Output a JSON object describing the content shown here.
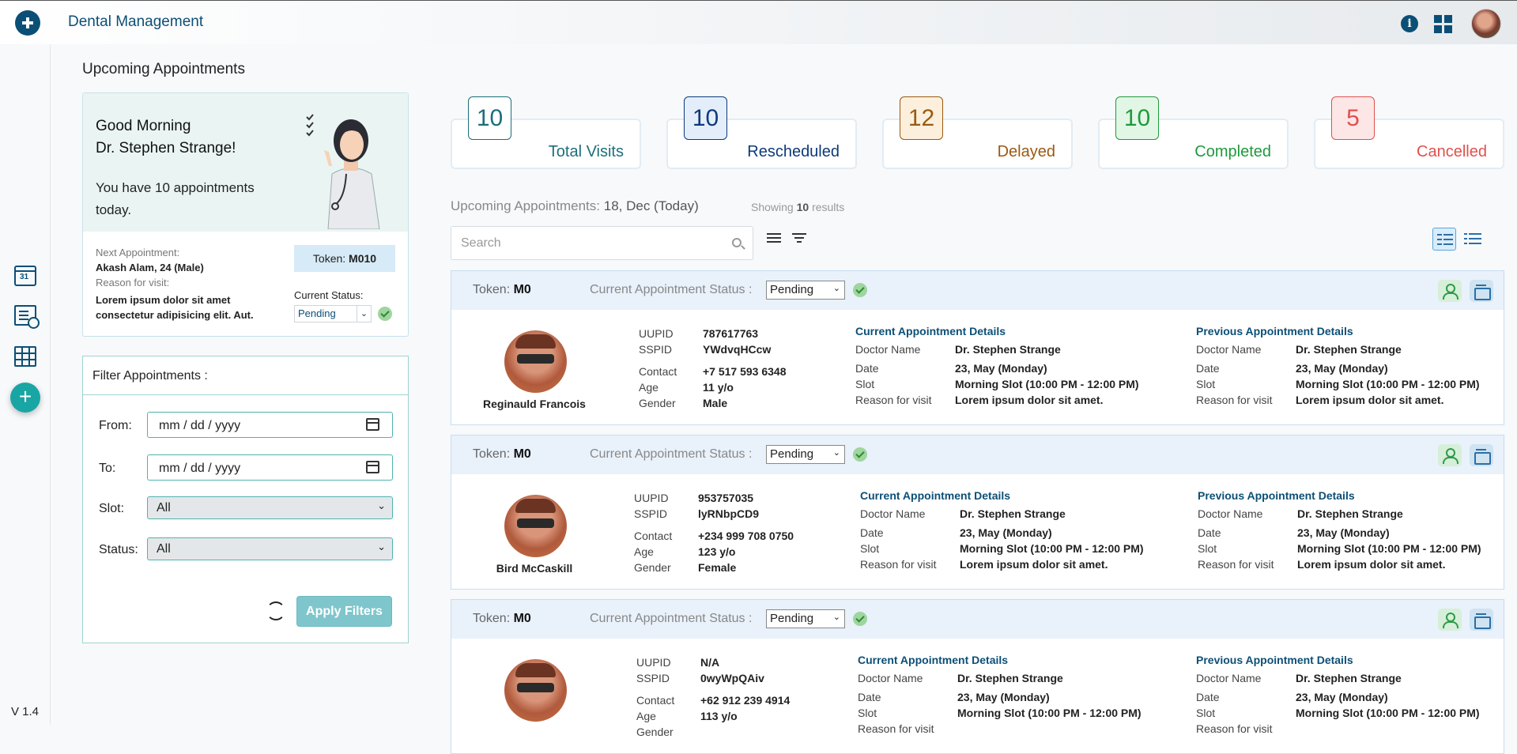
{
  "app": {
    "title": "Dental Management",
    "version": "V 1.4"
  },
  "page_title": "Upcoming Appointments",
  "welcome": {
    "greeting_line1": "Good Morning",
    "greeting_line2": "Dr. Stephen Strange!",
    "appointments_text": "You have 10 appointments today.",
    "next_label": "Next Appointment:",
    "next_value": "Akash Alam, 24 (Male)",
    "reason_label": "Reason for visit:",
    "reason_value": "Lorem ipsum dolor sit amet consectetur adipisicing elit. Aut.",
    "token_label": "Token: ",
    "token_value": "M010",
    "status_label": "Current Status:",
    "status_value": "Pending"
  },
  "filter": {
    "title": "Filter Appointments :",
    "from_label": "From:",
    "from_value": "mm / dd / yyyy",
    "to_label": "To:",
    "to_value": "mm / dd / yyyy",
    "slot_label": "Slot:",
    "slot_value": "All",
    "status_label": "Status:",
    "status_value": "All",
    "apply_label": "Apply Filters"
  },
  "stats": [
    {
      "num": "10",
      "label": "Total Visits",
      "color": "#1c6e7a",
      "bg": "#ffffff"
    },
    {
      "num": "10",
      "label": "Rescheduled",
      "color": "#0d3a7a",
      "bg": "#e4eefb"
    },
    {
      "num": "12",
      "label": "Delayed",
      "color": "#9a5a10",
      "bg": "#fcefdc"
    },
    {
      "num": "10",
      "label": "Completed",
      "color": "#1e9a3c",
      "bg": "#e2f6e6"
    },
    {
      "num": "5",
      "label": "Cancelled",
      "color": "#e0504e",
      "bg": "#fde6e6"
    }
  ],
  "list_header": {
    "title": "Upcoming Appointments:",
    "date": "18, Dec (Today)",
    "showing_pre": "Showing",
    "showing_count": "10",
    "showing_post": "results"
  },
  "search": {
    "placeholder": "Search"
  },
  "card_labels": {
    "token": "Token:",
    "status": "Current Appointment Status :",
    "uupid": "UUPID",
    "sspid": "SSPID",
    "contact": "Contact",
    "age": "Age",
    "gender": "Gender",
    "current_title": "Current Appointment Details",
    "previous_title": "Previous Appointment Details",
    "doctor": "Doctor Name",
    "date": "Date",
    "slot": "Slot",
    "reason": "Reason for visit"
  },
  "appointments": [
    {
      "token": "M0",
      "status": "Pending",
      "name": "Reginauld Francois",
      "uupid": "787617763",
      "sspid": "YWdvqHCcw",
      "contact": "+7 517 593 6348",
      "age": "11 y/o",
      "gender": "Male",
      "cur_doctor": "Dr. Stephen Strange",
      "cur_date": "23, May (Monday)",
      "cur_slot": "Morning Slot (10:00 PM - 12:00 PM)",
      "cur_reason": "Lorem ipsum dolor sit amet.",
      "prev_doctor": "Dr. Stephen Strange",
      "prev_date": "23, May (Monday)",
      "prev_slot": "Morning Slot (10:00 PM - 12:00 PM)",
      "prev_reason": "Lorem ipsum dolor sit amet."
    },
    {
      "token": "M0",
      "status": "Pending",
      "name": "Bird McCaskill",
      "uupid": "953757035",
      "sspid": "lyRNbpCD9",
      "contact": "+234 999 708 0750",
      "age": "123 y/o",
      "gender": "Female",
      "cur_doctor": "Dr. Stephen Strange",
      "cur_date": "23, May (Monday)",
      "cur_slot": "Morning Slot (10:00 PM - 12:00 PM)",
      "cur_reason": "Lorem ipsum dolor sit amet.",
      "prev_doctor": "Dr. Stephen Strange",
      "prev_date": "23, May (Monday)",
      "prev_slot": "Morning Slot (10:00 PM - 12:00 PM)",
      "prev_reason": "Lorem ipsum dolor sit amet."
    },
    {
      "token": "M0",
      "status": "Pending",
      "name": "",
      "uupid": "N/A",
      "sspid": "0wyWpQAiv",
      "contact": "+62 912 239 4914",
      "age": "113 y/o",
      "gender": "",
      "cur_doctor": "Dr. Stephen Strange",
      "cur_date": "23, May (Monday)",
      "cur_slot": "Morning Slot (10:00 PM - 12:00 PM)",
      "cur_reason": "",
      "prev_doctor": "Dr. Stephen Strange",
      "prev_date": "23, May (Monday)",
      "prev_slot": "Morning Slot (10:00 PM - 12:00 PM)",
      "prev_reason": ""
    }
  ]
}
